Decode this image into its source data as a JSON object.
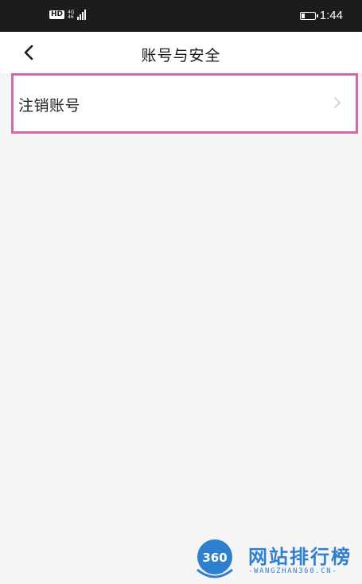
{
  "status_bar": {
    "hd_label": "HD",
    "network_top": "4G",
    "network_bottom": "46",
    "time": "1:44",
    "battery_level": 0.25
  },
  "header": {
    "title": "账号与安全",
    "back_icon": "chevron-left-icon"
  },
  "settings": {
    "items": [
      {
        "label": "注销账号",
        "icon": "chevron-right-icon"
      }
    ]
  },
  "watermark": {
    "logo_text": "360",
    "title": "网站排行榜",
    "subtitle": "-WANGZHAN360.CN-",
    "color": "#2f7fd1"
  },
  "colors": {
    "status_bar_bg": "#1c1c1c",
    "page_bg": "#f5f5f5",
    "highlight_border": "#d26aa9"
  }
}
